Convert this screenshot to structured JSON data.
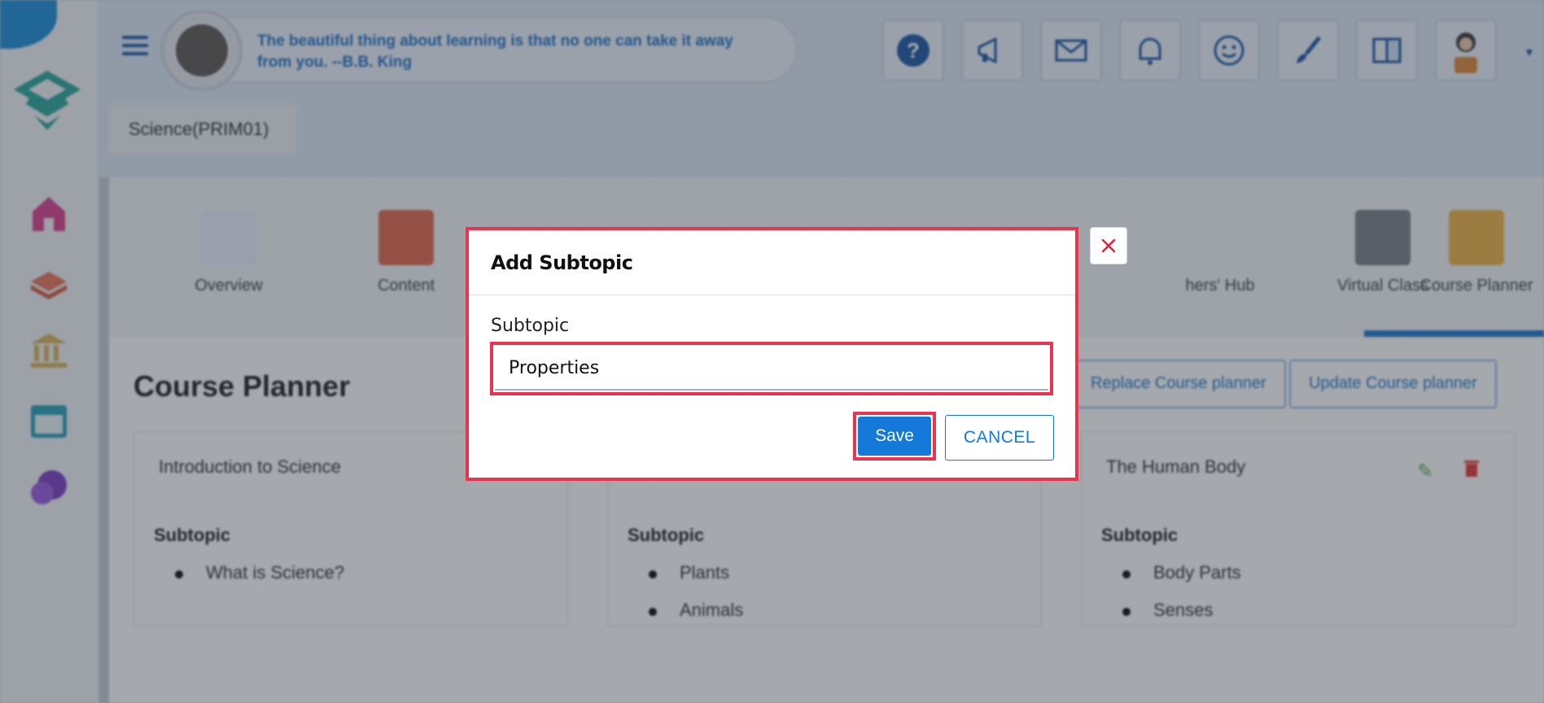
{
  "header": {
    "quote": "The beautiful thing about learning is that no one can take it away from you. --B.B. King",
    "course_chip": "Science(PRIM01)",
    "top_buttons": [
      "help-icon",
      "megaphone-icon",
      "mail-icon",
      "bell-icon",
      "smiley-icon",
      "brush-icon",
      "book-icon",
      "profile-avatar"
    ]
  },
  "sidebar": {
    "items": [
      "home-icon",
      "books-icon",
      "institution-icon",
      "calendar-icon",
      "chat-icon"
    ]
  },
  "tabs": [
    {
      "label": "Overview"
    },
    {
      "label": "Content"
    },
    {
      "label": "hers' Hub"
    },
    {
      "label": "Virtual Class"
    },
    {
      "label": "Course Planner"
    }
  ],
  "page": {
    "title": "Course Planner",
    "replace_button": "Replace Course planner",
    "update_button": "Update Course planner"
  },
  "cards": [
    {
      "title": "Introduction to Science",
      "subtopic_heading": "Subtopic",
      "items": [
        "What is Science?"
      ]
    },
    {
      "title": "",
      "subtopic_heading": "Subtopic",
      "items": [
        "Plants",
        "Animals"
      ]
    },
    {
      "title": "The Human Body",
      "subtopic_heading": "Subtopic",
      "items": [
        "Body Parts",
        "Senses"
      ]
    }
  ],
  "modal": {
    "title": "Add Subtopic",
    "field_label": "Subtopic",
    "field_value": "Properties",
    "save_label": "Save",
    "cancel_label": "CANCEL",
    "close_glyph": "×"
  },
  "colors": {
    "highlight": "#e8344e",
    "primary": "#1479d9",
    "quote_text": "#1e73c8"
  }
}
